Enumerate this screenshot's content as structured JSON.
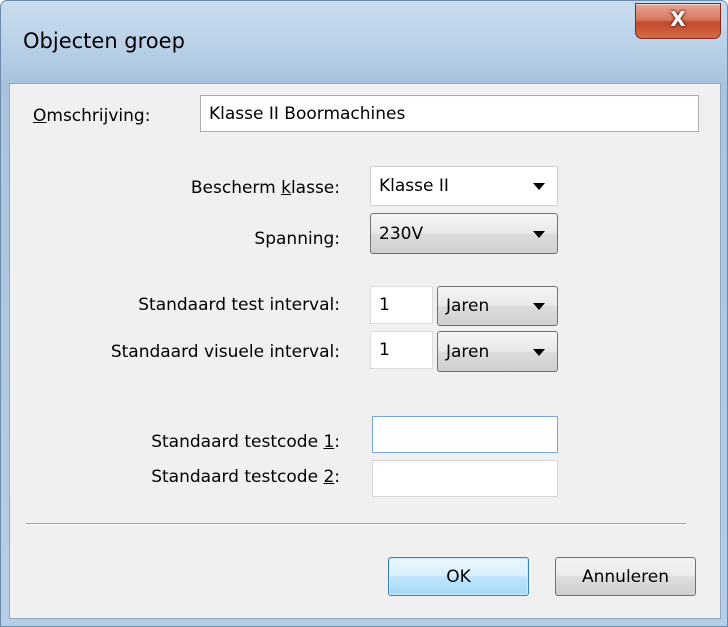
{
  "window": {
    "title": "Objecten groep",
    "close_glyph": "X"
  },
  "form": {
    "description": {
      "label_prefix": "",
      "label_hotkey": "O",
      "label_rest": "mschrijving:",
      "value": "Klasse II Boormachines"
    },
    "protection_class": {
      "label_before": "Bescherm ",
      "label_hotkey": "k",
      "label_after": "lasse:",
      "value": "Klasse II"
    },
    "voltage": {
      "label": "Spanning:",
      "value": "230V"
    },
    "test_interval": {
      "label": "Standaard test interval:",
      "value": "1",
      "unit": "Jaren"
    },
    "visual_interval": {
      "label": "Standaard visuele interval:",
      "value": "1",
      "unit": "Jaren"
    },
    "testcode_1": {
      "label_before": "Standaard testcode ",
      "label_hotkey": "1",
      "label_after": ":",
      "value": ""
    },
    "testcode_2": {
      "label_before": "Standaard testcode ",
      "label_hotkey": "2",
      "label_after": ":",
      "value": ""
    }
  },
  "buttons": {
    "ok": "OK",
    "cancel": "Annuleren"
  },
  "icons": {
    "close": "close-icon",
    "dropdown": "chevron-down-icon"
  }
}
